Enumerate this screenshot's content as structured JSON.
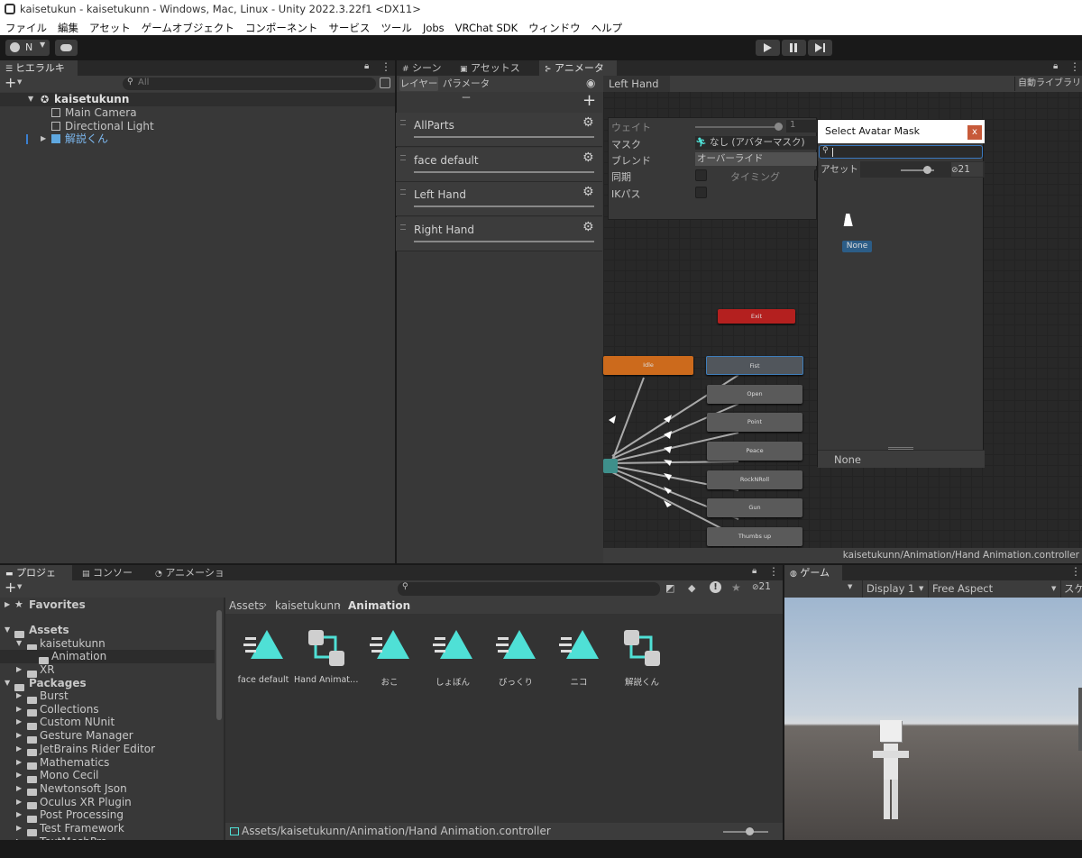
{
  "window": {
    "title": "kaisetukun - kaisetukunn - Windows, Mac, Linux - Unity 2022.3.22f1 <DX11>"
  },
  "menu": [
    "ファイル",
    "編集",
    "アセット",
    "ゲームオブジェクト",
    "コンポーネント",
    "サービス",
    "ツール",
    "Jobs",
    "VRChat SDK",
    "ウィンドウ",
    "ヘルプ"
  ],
  "toolbar": {
    "account_label": "N"
  },
  "hierarchy": {
    "tab": "ヒエラルキー",
    "search_placeholder": "All",
    "scene": "kaisetukunn",
    "items": [
      "Main Camera",
      "Directional Light",
      "解説くん"
    ]
  },
  "center_tabs": [
    "シーン",
    "アセットストア",
    "アニメーター"
  ],
  "animator": {
    "subtabs": [
      "レイヤー",
      "パラメーター"
    ],
    "breadcrumb": "Left Hand",
    "auto_layout": "自動ライブラリング",
    "layers": [
      "AllParts",
      "face default",
      "Left Hand",
      "Right Hand"
    ],
    "settings": {
      "weight_label": "ウェイト",
      "weight_value": "1",
      "mask_label": "マスク",
      "mask_value": "なし (アバターマスク)",
      "blend_label": "ブレンド",
      "blend_value": "オーバーライド",
      "sync_label": "同期",
      "timing_label": "タイミング",
      "ik_label": "IKパス"
    },
    "states": {
      "exit": "Exit",
      "idle": "Idle",
      "list": [
        "Fist",
        "Open",
        "Point",
        "Peace",
        "RockNRoll",
        "Gun",
        "Thumbs up"
      ]
    },
    "status_path": "kaisetukunn/Animation/Hand Animation.controller"
  },
  "mask_picker": {
    "title": "Select Avatar Mask",
    "close": "x",
    "search_value": "",
    "tab_assets": "アセット",
    "count": "21",
    "item": "None",
    "footer": "None"
  },
  "bottom_tabs": [
    "プロジェクト",
    "コンソール",
    "アニメーション"
  ],
  "project": {
    "favorites": "Favorites",
    "assets": "Assets",
    "tree": [
      "kaisetukunn",
      "Animation",
      "XR"
    ],
    "packages_label": "Packages",
    "packages": [
      "Burst",
      "Collections",
      "Custom NUnit",
      "Gesture Manager",
      "JetBrains Rider Editor",
      "Mathematics",
      "Mono Cecil",
      "Newtonsoft Json",
      "Oculus XR Plugin",
      "Post Processing",
      "Test Framework",
      "TextMeshPro"
    ],
    "breadcrumb": [
      "Assets",
      "kaisetukunn",
      "Animation"
    ],
    "count": "21",
    "assets_grid": [
      {
        "name": "face default",
        "kind": "anim"
      },
      {
        "name": "Hand Animation.controller",
        "kind": "controller"
      },
      {
        "name": "おこ",
        "kind": "anim"
      },
      {
        "name": "しょぼん",
        "kind": "anim"
      },
      {
        "name": "びっくり",
        "kind": "anim"
      },
      {
        "name": "ニコ",
        "kind": "anim"
      },
      {
        "name": "解説くん",
        "kind": "controller"
      }
    ],
    "footer_path": "Assets/kaisetukunn/Animation/Hand Animation.controller"
  },
  "game": {
    "tab": "ゲーム",
    "display": "Display 1",
    "aspect": "Free Aspect",
    "scale_label": "スケ"
  },
  "colors": {
    "idle": "#cc6a1c",
    "exit": "#b4201f",
    "accent": "#4fe0d6",
    "selected": "#2c5d87"
  }
}
